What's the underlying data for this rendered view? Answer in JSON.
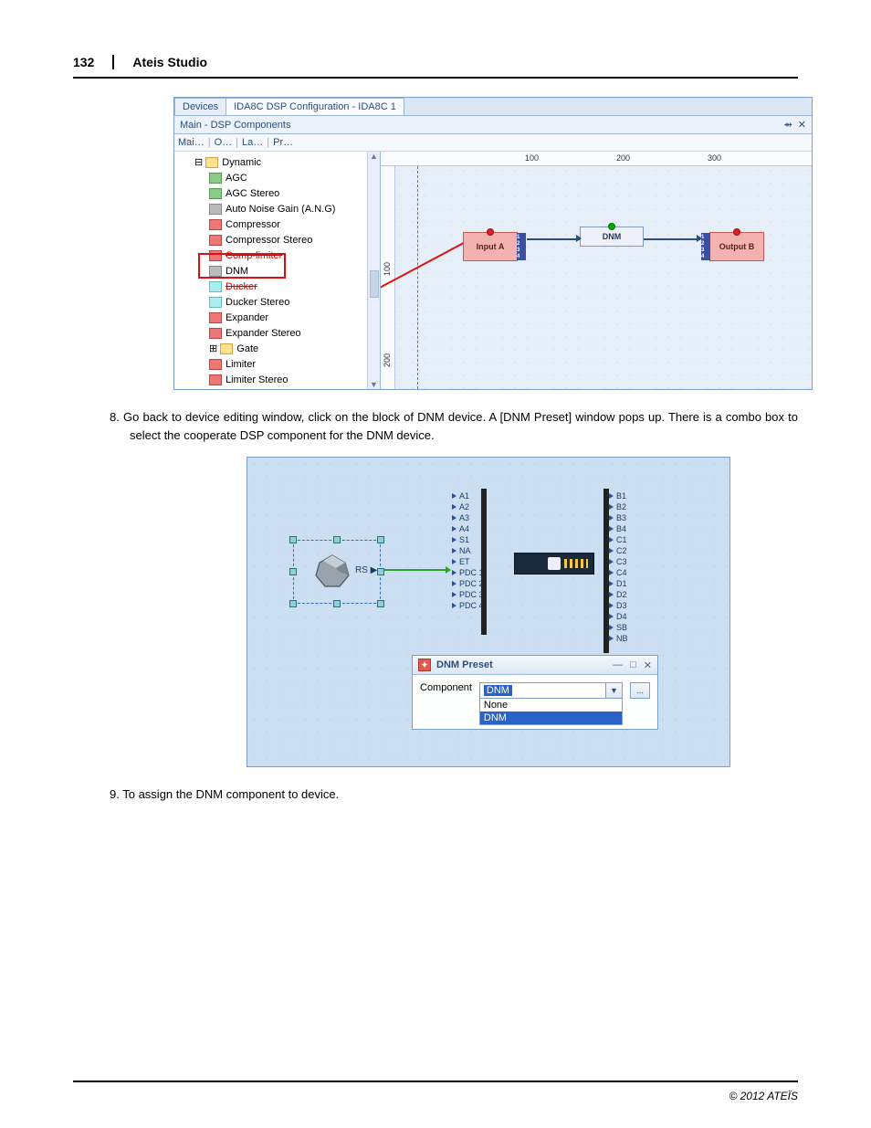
{
  "page": {
    "number": "132",
    "header": "Ateis Studio",
    "footer": "© 2012 ATEÏS"
  },
  "steps": {
    "s8_num": "8.",
    "s8_text": "Go back to device editing window, click on the block of DNM device. A [DNM Preset] window pops up. There is a combo box to select the cooperate  DSP component for the DNM device.",
    "s9_num": "9.",
    "s9_text": "To assign the DNM component to device."
  },
  "fig1": {
    "tab_devices": "Devices",
    "tab_config": "IDA8C DSP Configuration - IDA8C 1",
    "panel_title": "Main - DSP Components",
    "pin_icon": "⇴",
    "close_icon": "✕",
    "toolbar": {
      "t1": "Mai…",
      "t2": "O…",
      "t3": "La…",
      "t4": "Pr…"
    },
    "tree": {
      "folder": "Dynamic",
      "items": {
        "agc": "AGC",
        "agc_stereo": "AGC Stereo",
        "ang": "Auto Noise Gain (A.N.G)",
        "comp": "Compressor",
        "comp_stereo": "Compressor Stereo",
        "comp_lim": "Comp-limiter",
        "dnm": "DNM",
        "ducker": "Ducker",
        "ducker_stereo": "Ducker Stereo",
        "expander": "Expander",
        "expander_stereo": "Expander Stereo",
        "gate": "Gate",
        "limiter": "Limiter",
        "limiter_stereo": "Limiter Stereo"
      }
    },
    "ruler": {
      "r100": "100",
      "r200": "200",
      "r300": "300",
      "v100": "100",
      "v200": "200"
    },
    "blocks": {
      "input": "Input A",
      "dnm": "DNM",
      "output": "Output B"
    },
    "ports": {
      "p1": "1",
      "p2": "2",
      "p3": "3",
      "p4": "4"
    }
  },
  "fig2": {
    "rs_label": "RS",
    "ports_left": {
      "a1": "A1",
      "a2": "A2",
      "a3": "A3",
      "a4": "A4",
      "s1": "S1",
      "na": "NA",
      "et": "ET",
      "pdc1": "PDC 1",
      "pdc2": "PDC 2",
      "pdc3": "PDC 3",
      "pdc4": "PDC 4"
    },
    "ports_right": {
      "b1": "B1",
      "b2": "B2",
      "b3": "B3",
      "b4": "B4",
      "c1": "C1",
      "c2": "C2",
      "c3": "C3",
      "c4": "C4",
      "d1": "D1",
      "d2": "D2",
      "d3": "D3",
      "d4": "D4",
      "sb": "SB",
      "nb": "NB"
    },
    "preset": {
      "title": "DNM Preset",
      "min": "—",
      "max": "□",
      "close": "✕",
      "label": "Component",
      "selected": "DNM",
      "more": "...",
      "options": {
        "none": "None",
        "dnm": "DNM"
      }
    }
  }
}
